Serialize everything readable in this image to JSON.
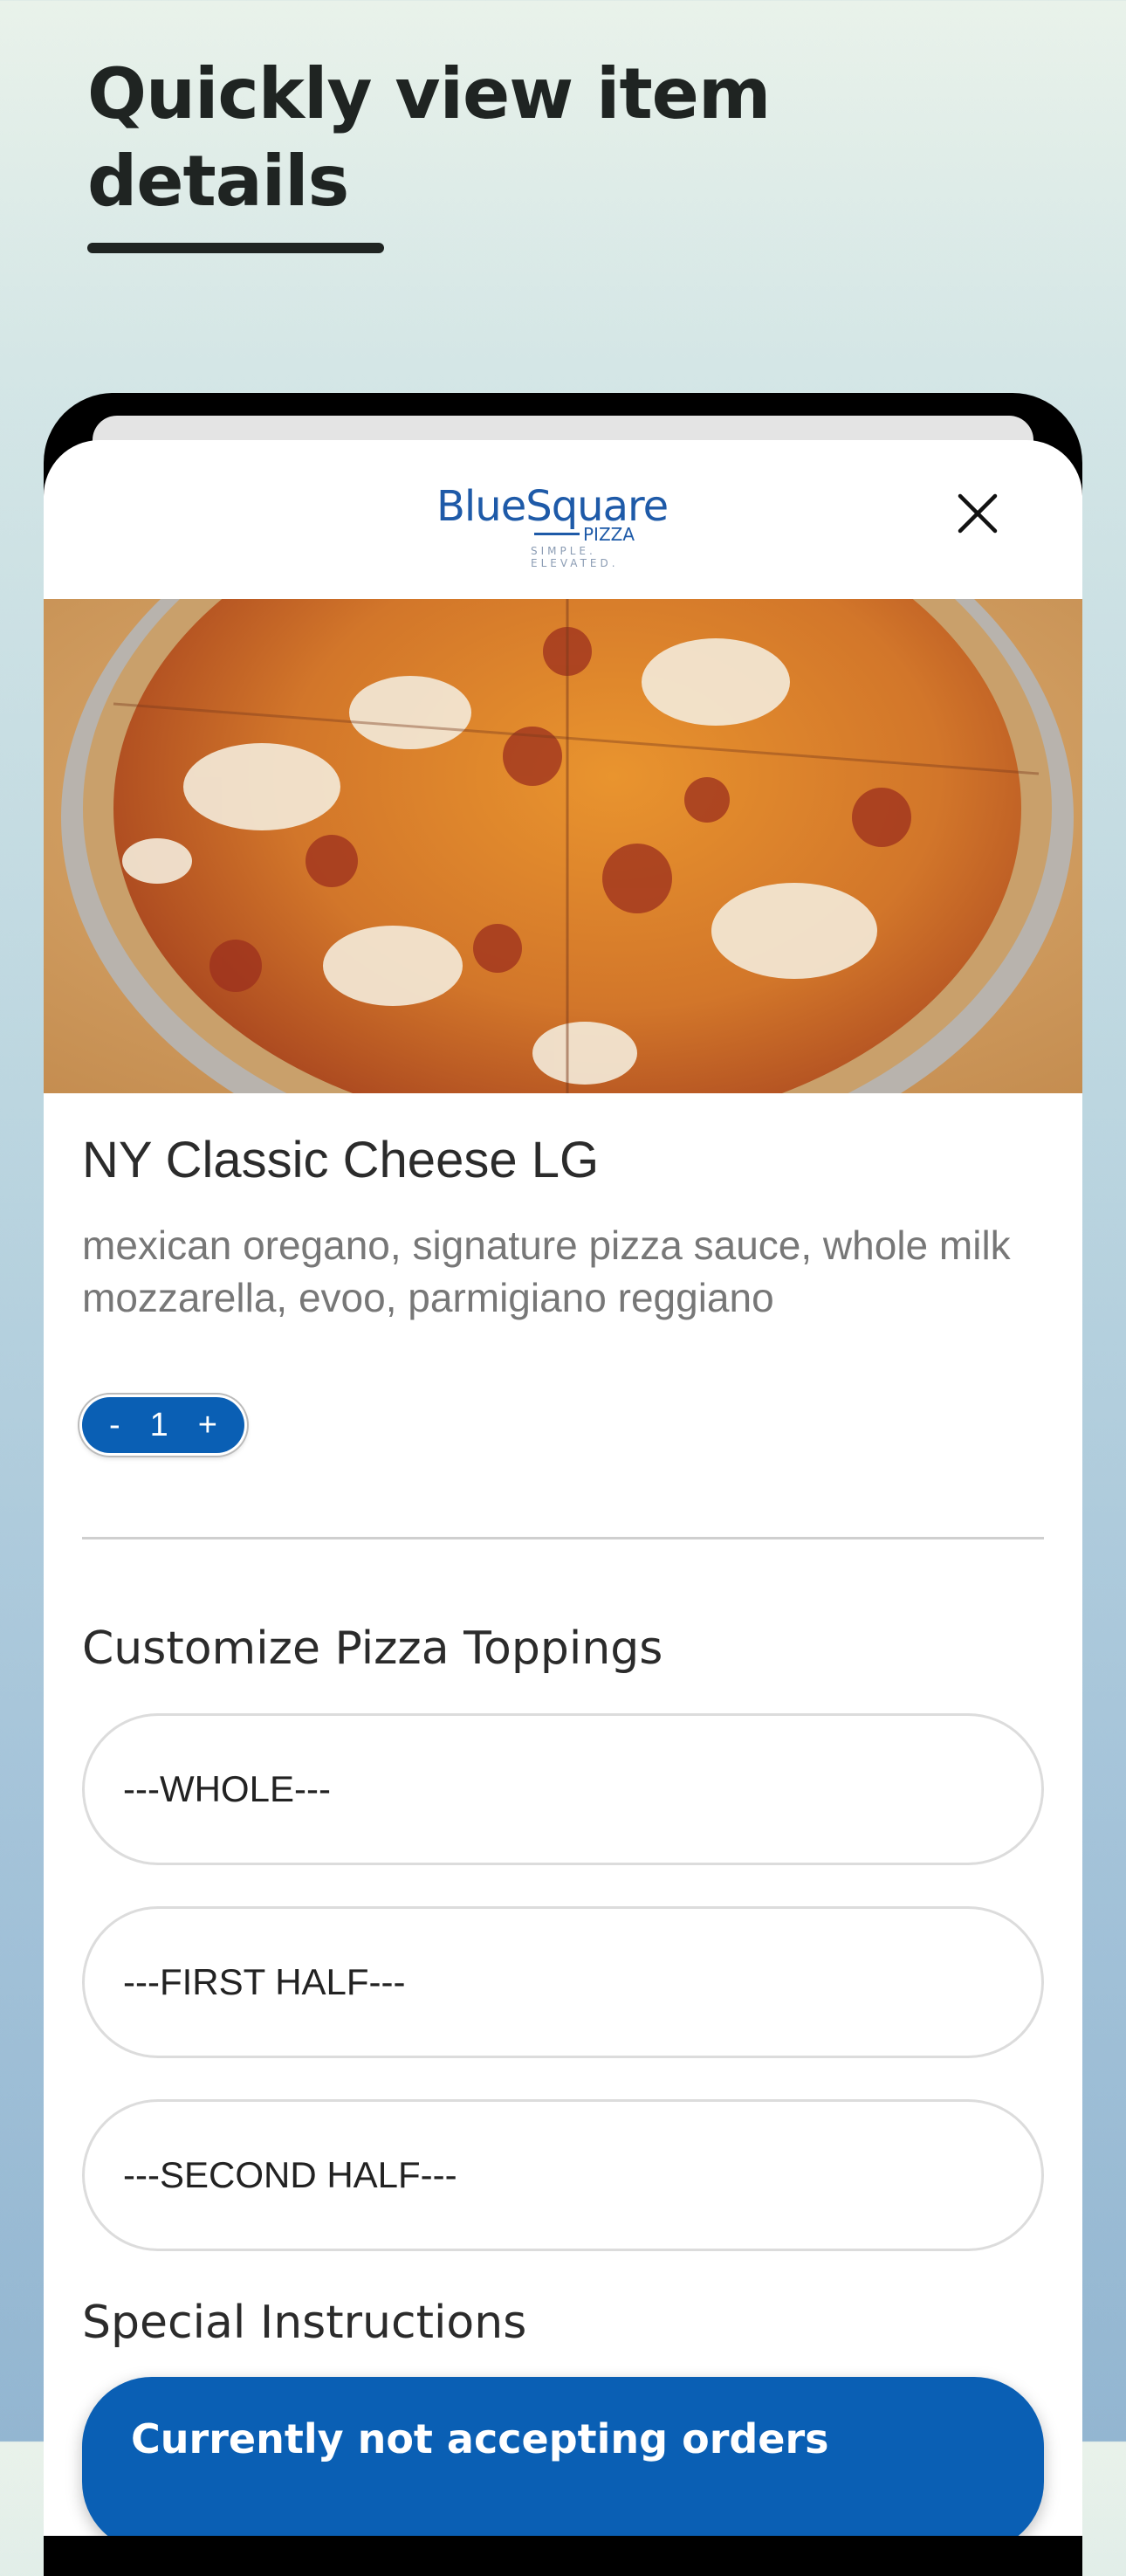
{
  "promo": {
    "headline": "Quickly view item details"
  },
  "header": {
    "logo_main": "BlueSquare",
    "logo_sub": "PIZZA",
    "logo_tagline": "SIMPLE. ELEVATED.",
    "close_icon": "close-icon"
  },
  "item": {
    "image_icon": "pizza-photo",
    "title": "NY Classic Cheese LG",
    "description": "mexican oregano, signature pizza sauce, whole milk mozzarella, evoo, parmigiano reggiano"
  },
  "quantity": {
    "decrement": "-",
    "value": "1",
    "increment": "+"
  },
  "toppings": {
    "title": "Customize Pizza Toppings",
    "options": [
      "---WHOLE---",
      "---FIRST HALF---",
      "---SECOND HALF---"
    ]
  },
  "instructions": {
    "title": "Special Instructions"
  },
  "order_status": {
    "text": "Currently not accepting orders"
  },
  "colors": {
    "brand_blue": "#0a5fb4",
    "logo_blue": "#1e5aa8",
    "background_top": "#e9f2ea",
    "background_bottom": "#93b6d1"
  }
}
